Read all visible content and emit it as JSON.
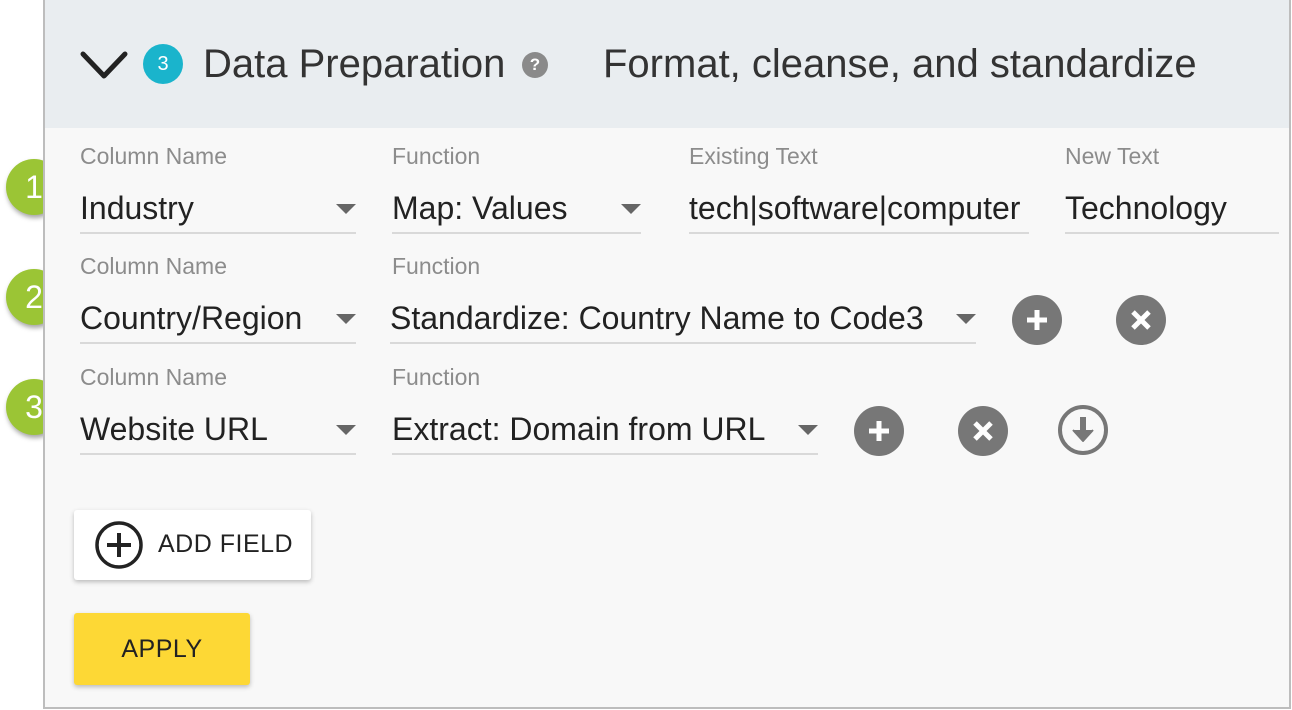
{
  "header": {
    "step_number": "3",
    "title": "Data Preparation",
    "help_symbol": "?",
    "subtitle": "Format, cleanse, and standardize"
  },
  "rows": [
    {
      "marker": "1",
      "column_label": "Column Name",
      "column_value": "Industry",
      "function_label": "Function",
      "function_value": "Map: Values",
      "existing_label": "Existing Text",
      "existing_value": "tech|software|computer",
      "new_label": "New Text",
      "new_value": "Technology"
    },
    {
      "marker": "2",
      "column_label": "Column Name",
      "column_value": "Country/Region",
      "function_label": "Function",
      "function_value": "Standardize: Country Name to Code3"
    },
    {
      "marker": "3",
      "column_label": "Column Name",
      "column_value": "Website URL",
      "function_label": "Function",
      "function_value": "Extract: Domain from URL"
    }
  ],
  "buttons": {
    "add_field": "ADD FIELD",
    "apply": "APPLY"
  },
  "icons": {
    "collapse": "chevron-down-icon",
    "help": "help-icon",
    "add": "plus-circle-icon",
    "remove": "close-circle-icon",
    "move_down": "arrow-down-circle-icon"
  },
  "colors": {
    "header_bg": "#e9edf0",
    "step_badge": "#1ab4cc",
    "row_marker": "#9bc535",
    "apply_button": "#fdd835",
    "icon_button": "#777777"
  }
}
